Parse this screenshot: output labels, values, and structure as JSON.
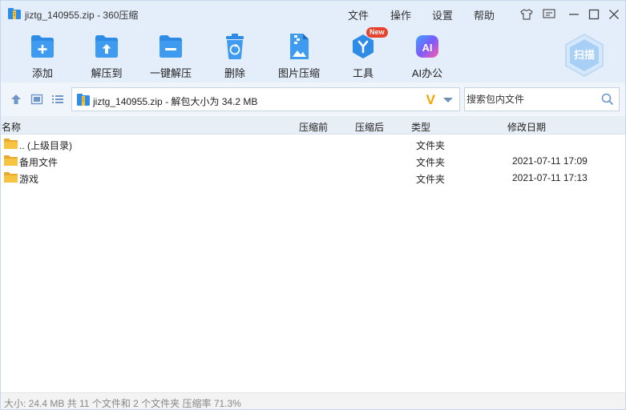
{
  "window": {
    "title": "jiztg_140955.zip - 360压缩",
    "menu": [
      "文件",
      "操作",
      "设置",
      "帮助"
    ],
    "icons": [
      "shirt-icon",
      "message-icon",
      "minimize-icon",
      "maximize-icon",
      "close-icon"
    ]
  },
  "toolbar": {
    "items": [
      {
        "label": "添加",
        "icon": "add-icon"
      },
      {
        "label": "解压到",
        "icon": "extract-to-icon"
      },
      {
        "label": "一键解压",
        "icon": "one-click-extract-icon"
      },
      {
        "label": "删除",
        "icon": "recycle-bin-icon"
      },
      {
        "label": "图片压缩",
        "icon": "image-compress-icon"
      },
      {
        "label": "工具",
        "icon": "tools-icon",
        "badge": "New"
      },
      {
        "label": "AI办公",
        "icon": "ai-office-icon",
        "icon_text": "AI"
      }
    ],
    "scan_label": "扫描"
  },
  "address": {
    "path": "jiztg_140955.zip - 解包大小为 34.2 MB",
    "logo_text": "V"
  },
  "search": {
    "placeholder": "搜索包内文件"
  },
  "columns": {
    "name": "名称",
    "compressed": "压缩前",
    "original": "压缩后",
    "type": "类型",
    "modified": "修改日期"
  },
  "rows": [
    {
      "name": ".. (上级目录)",
      "type": "文件夹",
      "modified": ""
    },
    {
      "name": "备用文件",
      "type": "文件夹",
      "modified": "2021-07-11 17:09"
    },
    {
      "name": "游戏",
      "type": "文件夹",
      "modified": "2021-07-11 17:13"
    }
  ],
  "status": "大小: 24.4 MB 共 11 个文件和 2 个文件夹 压缩率 71.3%",
  "colors": {
    "accent_blue": "#2e8be6",
    "toolbar_bg": "#e4eefb",
    "folder": "#f7c441",
    "new_badge": "#e8412c"
  }
}
